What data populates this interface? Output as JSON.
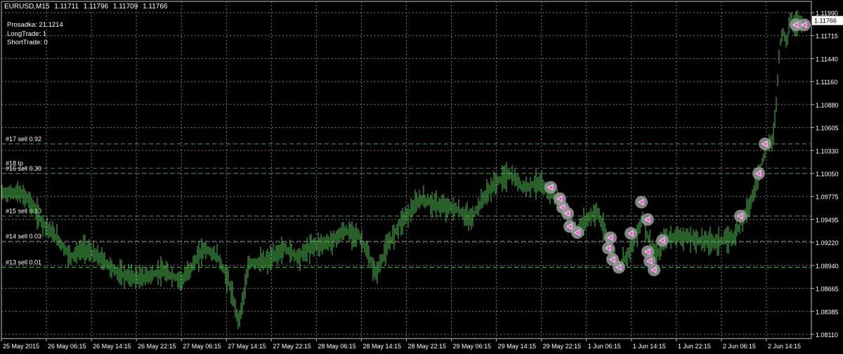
{
  "header": {
    "symbol": "EURUSD,M15",
    "open": "1.11711",
    "high": "1.11796",
    "low": "1.11709",
    "close": "1.11766"
  },
  "info": {
    "prosadka": "Prosadka: 21.1214",
    "long_trade": "LongTrade: 1",
    "short_trade": "ShortTrade: 0"
  },
  "colors": {
    "background": "#000000",
    "grid": "#7a7a7a",
    "bar": "#4ec24e",
    "level_line": "#3aa83a",
    "tp_line": "#c83232",
    "text": "#ffffff",
    "marker": "#9a9a9a"
  },
  "chart_data": {
    "type": "bar",
    "title": "EURUSD,M15",
    "y_ticks": [
      "1.11990",
      "1.11715",
      "1.11440",
      "1.11160",
      "1.10880",
      "1.10605",
      "1.10330",
      "1.10050",
      "1.09775",
      "1.09495",
      "1.09220",
      "1.08940",
      "1.08665",
      "1.08385",
      "1.08110"
    ],
    "ylim": [
      1.0811,
      1.1199
    ],
    "current_price": "1.11766",
    "x_ticks": [
      "25 May 2015",
      "26 May 06:15",
      "26 May 14:15",
      "26 May 22:15",
      "27 May 06:15",
      "27 May 14:15",
      "27 May 22:15",
      "28 May 06:15",
      "28 May 14:15",
      "28 May 22:15",
      "29 May 06:15",
      "29 May 14:15",
      "29 May 22:15",
      "1 Jun 06:15",
      "1 Jun 14:15",
      "1 Jun 22:15",
      "2 Jun 06:15",
      "2 Jun 14:15"
    ],
    "levels": [
      {
        "label": "#17 sell 0.92",
        "price": 1.1035
      },
      {
        "label": "#18 tp",
        "price": 1.1007
      },
      {
        "label": "#16 sell 0.30",
        "price": 1.1001
      },
      {
        "label": "#15 sell 0.10",
        "price": 1.0952
      },
      {
        "label": "#14 sell 0.03",
        "price": 1.0923
      },
      {
        "label": "#13 sell 0.01",
        "price": 1.0893
      }
    ],
    "series": [
      {
        "points": [
          [
            0,
            1.0978
          ],
          [
            25,
            1.0979
          ],
          [
            40,
            1.0972
          ],
          [
            60,
            1.0945
          ],
          [
            80,
            1.0928
          ],
          [
            100,
            1.0905
          ],
          [
            120,
            1.0915
          ],
          [
            145,
            1.0902
          ],
          [
            170,
            1.0885
          ],
          [
            200,
            1.088
          ],
          [
            230,
            1.0888
          ],
          [
            260,
            1.0878
          ],
          [
            290,
            1.0915
          ],
          [
            310,
            1.0905
          ],
          [
            325,
            1.0878
          ],
          [
            340,
            1.083
          ],
          [
            355,
            1.0898
          ],
          [
            380,
            1.09
          ],
          [
            405,
            1.0915
          ],
          [
            425,
            1.0905
          ],
          [
            445,
            1.0918
          ],
          [
            470,
            1.0922
          ],
          [
            490,
            1.0935
          ],
          [
            510,
            1.093
          ],
          [
            520,
            1.0915
          ],
          [
            535,
            1.0885
          ],
          [
            550,
            1.0915
          ],
          [
            570,
            1.0945
          ],
          [
            600,
            1.0972
          ],
          [
            620,
            1.0965
          ],
          [
            650,
            1.096
          ],
          [
            670,
            1.0948
          ],
          [
            690,
            1.0975
          ],
          [
            705,
            1.099
          ],
          [
            725,
            1.1
          ],
          [
            745,
            1.0985
          ],
          [
            765,
            1.099
          ],
          [
            790,
            1.0975
          ],
          [
            805,
            1.0955
          ],
          [
            820,
            1.0935
          ],
          [
            835,
            1.0948
          ],
          [
            850,
            1.0958
          ],
          [
            862,
            1.093
          ],
          [
            872,
            1.0905
          ],
          [
            882,
            1.0895
          ],
          [
            895,
            1.091
          ],
          [
            905,
            1.093
          ],
          [
            915,
            1.095
          ],
          [
            925,
            1.092
          ],
          [
            935,
            1.0905
          ],
          [
            945,
            1.0925
          ],
          [
            965,
            1.093
          ],
          [
            990,
            1.0925
          ],
          [
            1020,
            1.0922
          ],
          [
            1045,
            1.0928
          ],
          [
            1060,
            1.0955
          ],
          [
            1070,
            1.097
          ],
          [
            1080,
            1.1
          ],
          [
            1090,
            1.103
          ],
          [
            1100,
            1.104
          ],
          [
            1105,
            1.108
          ],
          [
            1110,
            1.115
          ],
          [
            1115,
            1.1165
          ],
          [
            1120,
            1.115
          ],
          [
            1125,
            1.118
          ],
          [
            1130,
            1.1172
          ],
          [
            1140,
            1.1176
          ]
        ]
      }
    ],
    "trade_markers": [
      {
        "x": 784,
        "price": 1.0985
      },
      {
        "x": 797,
        "price": 1.0972
      },
      {
        "x": 801,
        "price": 1.0962
      },
      {
        "x": 808,
        "price": 1.0955
      },
      {
        "x": 811,
        "price": 1.094
      },
      {
        "x": 822,
        "price": 1.0933
      },
      {
        "x": 869,
        "price": 1.0927
      },
      {
        "x": 866,
        "price": 1.0915
      },
      {
        "x": 872,
        "price": 1.0902
      },
      {
        "x": 881,
        "price": 1.0893
      },
      {
        "x": 898,
        "price": 1.0932
      },
      {
        "x": 913,
        "price": 1.0968
      },
      {
        "x": 922,
        "price": 1.0948
      },
      {
        "x": 922,
        "price": 1.0911
      },
      {
        "x": 925,
        "price": 1.09
      },
      {
        "x": 931,
        "price": 1.089
      },
      {
        "x": 943,
        "price": 1.0924
      },
      {
        "x": 1054,
        "price": 1.0952
      },
      {
        "x": 1080,
        "price": 1.1001
      },
      {
        "x": 1089,
        "price": 1.1035
      },
      {
        "x": 1133,
        "price": 1.1172
      },
      {
        "x": 1145,
        "price": 1.1172
      }
    ]
  }
}
